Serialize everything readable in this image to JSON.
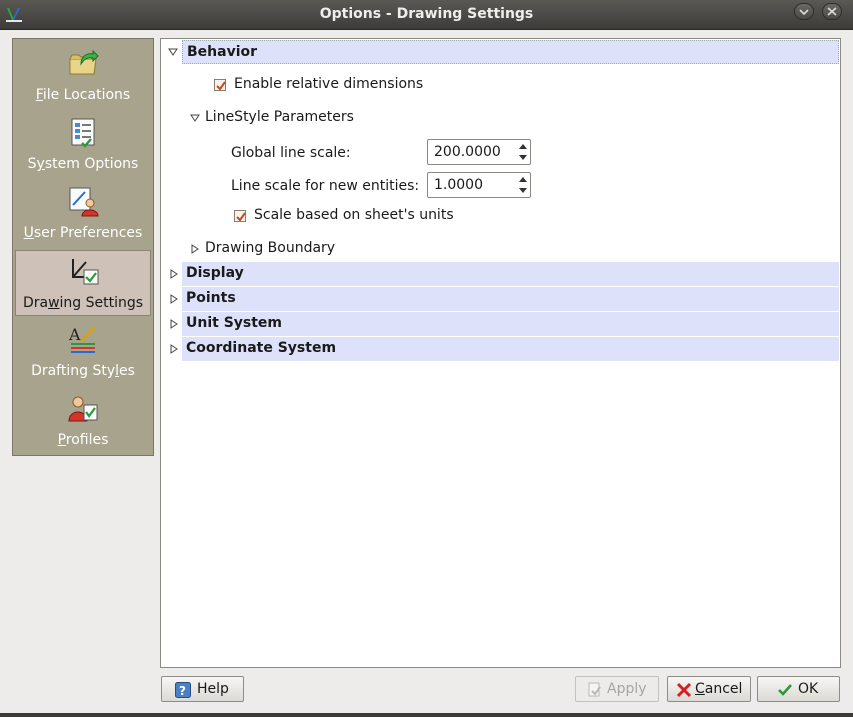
{
  "window": {
    "title": "Options - Drawing Settings"
  },
  "sidebar": {
    "items": [
      {
        "pre": "",
        "key": "F",
        "post": "ile Locations",
        "icon": "folder-arrow-icon"
      },
      {
        "pre": "S",
        "key": "y",
        "post": "stem Options",
        "icon": "checklist-icon"
      },
      {
        "pre": "",
        "key": "U",
        "post": "ser Preferences",
        "icon": "user-pen-icon"
      },
      {
        "pre": "Dra",
        "key": "w",
        "post": "ing Settings",
        "icon": "drawing-tools-icon",
        "selected": true
      },
      {
        "pre": "Drafting Sty",
        "key": "l",
        "post": "es",
        "icon": "drafting-styles-icon"
      },
      {
        "pre": "",
        "key": "P",
        "post": "rofiles",
        "icon": "user-check-icon"
      }
    ]
  },
  "settings": {
    "behavior": {
      "label": "Behavior",
      "enable_relative_dimensions": {
        "label": "Enable relative dimensions",
        "checked": true
      },
      "linestyle": {
        "label": "LineStyle Parameters",
        "global_line_scale": {
          "label": "Global line scale:",
          "value": "200.0000"
        },
        "line_scale_new_entities": {
          "label": "Line scale for new entities:",
          "value": "1.0000"
        },
        "scale_sheet_units": {
          "label": "Scale based on sheet's units",
          "checked": true
        }
      },
      "drawing_boundary": {
        "label": "Drawing Boundary"
      }
    },
    "display": {
      "label": "Display"
    },
    "points": {
      "label": "Points"
    },
    "unit_system": {
      "label": "Unit System"
    },
    "coordinate_system": {
      "label": "Coordinate System"
    }
  },
  "footer": {
    "help": "Help",
    "apply": "Apply",
    "cancel_pre": "",
    "cancel_key": "C",
    "cancel_post": "ancel",
    "ok": "OK"
  },
  "colors": {
    "sidebar_bg": "#a8a38c",
    "selected_item_bg": "#cdc1b8",
    "section_header_bg": "#dde2fa",
    "checkbox_mark": "#c9471a"
  }
}
